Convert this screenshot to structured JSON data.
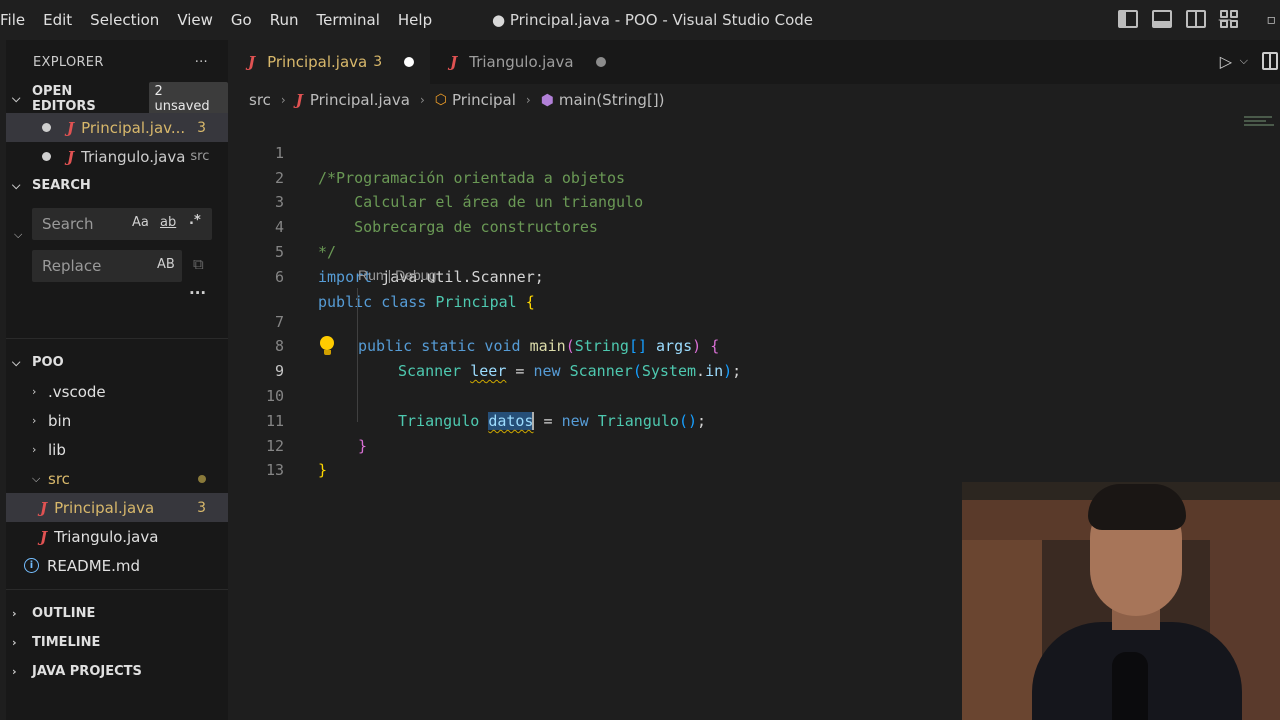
{
  "menu": [
    "File",
    "Edit",
    "Selection",
    "View",
    "Go",
    "Run",
    "Terminal",
    "Help"
  ],
  "window_title": "● Principal.java - POO - Visual Studio Code",
  "sidebar": {
    "header": "EXPLORER",
    "more": "···",
    "open_editors": {
      "title": "OPEN EDITORS",
      "badge": "2 unsaved",
      "items": [
        {
          "name": "Principal.jav...",
          "count": "3"
        },
        {
          "name": "Triangulo.java",
          "hint": "src"
        }
      ]
    },
    "search": {
      "title": "SEARCH",
      "search_placeholder": "Search",
      "match_case": "Aa",
      "whole_word": "ab",
      "regex": ".*",
      "replace_placeholder": "Replace",
      "preserve_case": "AB",
      "more": "···"
    },
    "project": {
      "title": "POO",
      "items": [
        {
          "name": ".vscode"
        },
        {
          "name": "bin"
        },
        {
          "name": "lib"
        },
        {
          "name": "src"
        },
        {
          "name": "Principal.java",
          "count": "3"
        },
        {
          "name": "Triangulo.java"
        },
        {
          "name": "README.md"
        }
      ]
    },
    "outline": "OUTLINE",
    "timeline": "TIMELINE",
    "java_projects": "JAVA PROJECTS"
  },
  "tabs": [
    {
      "label": "Principal.java",
      "count": "3"
    },
    {
      "label": "Triangulo.java"
    }
  ],
  "breadcrumb": {
    "folder": "src",
    "file": "Principal.java",
    "class": "Principal",
    "method": "main(String[])"
  },
  "code": {
    "line_numbers": [
      "1",
      "2",
      "3",
      "4",
      "5",
      "6",
      "7",
      "8",
      "9",
      "10",
      "11",
      "12",
      "13"
    ],
    "l1": "/*Programación orientada a objetos",
    "l2": "    Calcular el área de un triangulo",
    "l3": "    Sobrecarga de constructores",
    "l4": "*/",
    "l5_kw": "import",
    "l5_rest": " java.util.Scanner;",
    "l6_kw1": "public",
    "l6_kw2": " class ",
    "l6_name": "Principal",
    "l6_brace": " {",
    "codelens": "Run | Debug",
    "l7_kw": "public static void ",
    "l7_fn": "main",
    "l7_p1": "(",
    "l7_ty": "String",
    "l7_br": "[]",
    "l7_arg": " args",
    "l7_p2": ")",
    "l7_brace": " {",
    "l8_ty": "Scanner",
    "l8_var": "leer",
    "l8_eq": " = ",
    "l8_new": "new ",
    "l8_ty2": "Scanner",
    "l8_p1": "(",
    "l8_sys": "System",
    "l8_dot": ".",
    "l8_in": "in",
    "l8_p2": ")",
    "l8_end": ";",
    "l9_ty": "Triangulo",
    "l9_var": "datos",
    "l9_eq": " = ",
    "l9_new": "new ",
    "l9_ty2": "Triangulo",
    "l9_parens": "()",
    "l9_end": ";",
    "l11": "}",
    "l12": "}"
  }
}
